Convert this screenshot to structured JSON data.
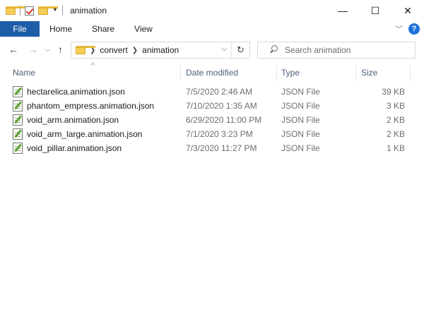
{
  "window": {
    "title": "animation",
    "controls": {
      "minimize": "—",
      "maximize": "☐",
      "close": "✕"
    }
  },
  "ribbon": {
    "file": "File",
    "tabs": [
      "Home",
      "Share",
      "View"
    ],
    "help": "?"
  },
  "nav": {
    "path": [
      "convert",
      "animation"
    ]
  },
  "search": {
    "placeholder": "Search animation"
  },
  "columns": {
    "name": "Name",
    "date": "Date modified",
    "type": "Type",
    "size": "Size"
  },
  "files": [
    {
      "name": "hectarelica.animation.json",
      "date": "7/5/2020 2:46 AM",
      "type": "JSON File",
      "size": "39 KB"
    },
    {
      "name": "phantom_empress.animation.json",
      "date": "7/10/2020 1:35 AM",
      "type": "JSON File",
      "size": "3 KB"
    },
    {
      "name": "void_arm.animation.json",
      "date": "6/29/2020 11:00 PM",
      "type": "JSON File",
      "size": "2 KB"
    },
    {
      "name": "void_arm_large.animation.json",
      "date": "7/1/2020 3:23 PM",
      "type": "JSON File",
      "size": "2 KB"
    },
    {
      "name": "void_pillar.animation.json",
      "date": "7/3/2020 11:27 PM",
      "type": "JSON File",
      "size": "1 KB"
    }
  ],
  "colors": {
    "file_tab": "#1e5ea8",
    "help": "#1d72d8",
    "folder": "#f6cd55"
  }
}
